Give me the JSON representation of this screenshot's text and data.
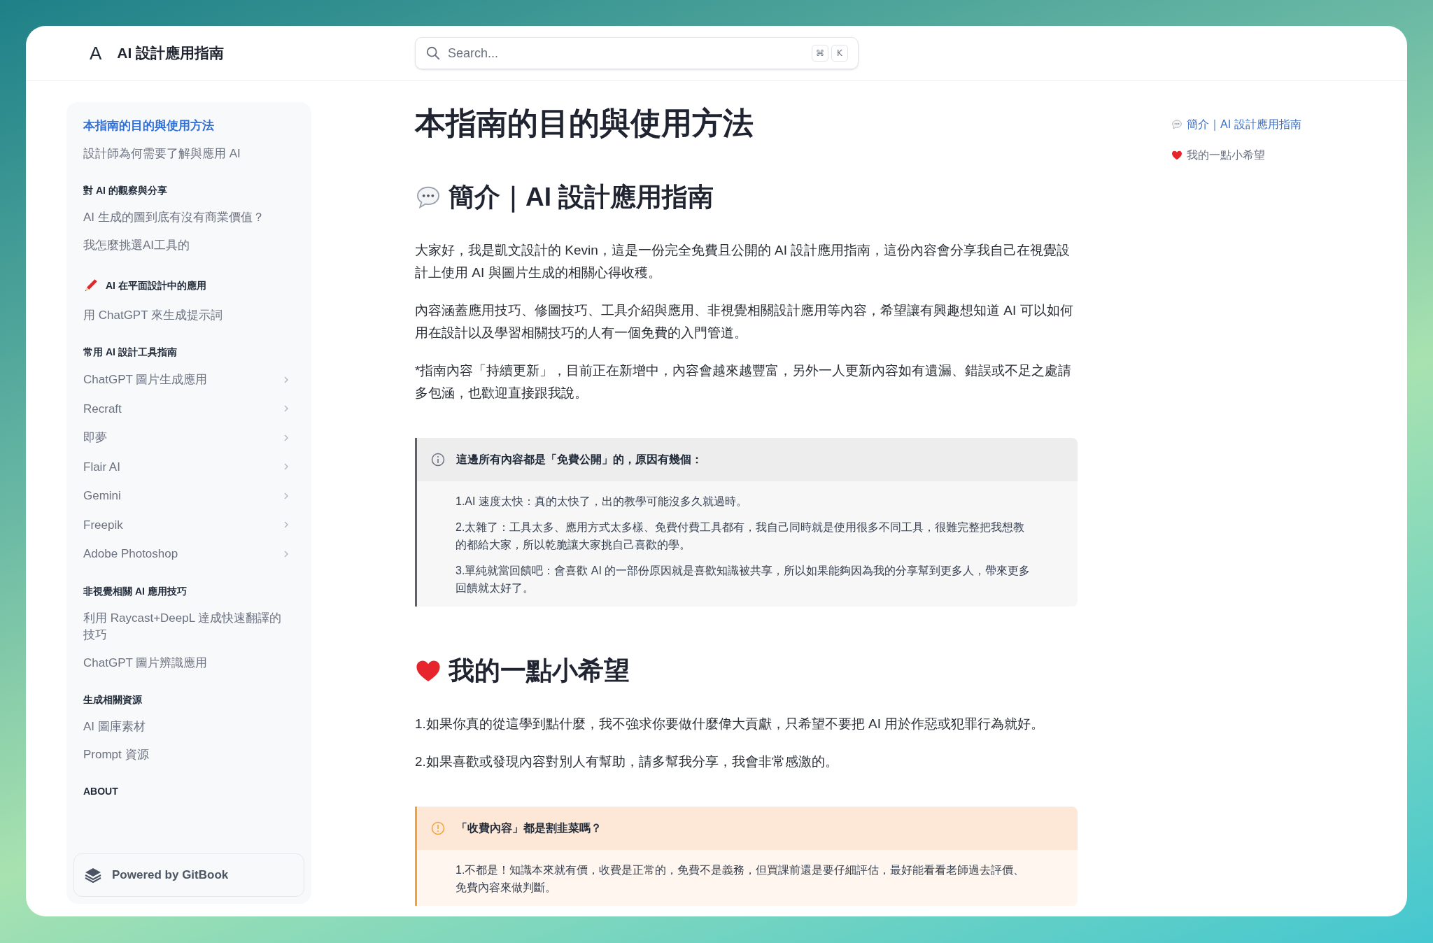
{
  "site": {
    "logo": "A",
    "title": "AI 設計應用指南"
  },
  "search": {
    "placeholder": "Search...",
    "shortcut": [
      "⌘",
      "K"
    ]
  },
  "sidebar": {
    "items": [
      {
        "kind": "page",
        "text": "本指南的目的與使用方法",
        "selected": true
      },
      {
        "kind": "page",
        "text": "設計師為何需要了解與應用 AI",
        "selected": false
      },
      {
        "kind": "section",
        "text": "對 AI 的觀察與分享"
      },
      {
        "kind": "page",
        "text": "AI 生成的圖到底有沒有商業價值？",
        "selected": false
      },
      {
        "kind": "page",
        "text": "我怎麼挑選AI工具的",
        "selected": false
      },
      {
        "kind": "marked_section",
        "text": "AI 在平面設計中的應用"
      },
      {
        "kind": "page",
        "text": "用 ChatGPT 來生成提示詞",
        "selected": false
      },
      {
        "kind": "section",
        "text": "常用 AI 設計工具指南"
      },
      {
        "kind": "group",
        "text": "ChatGPT 圖片生成應用",
        "selected": false
      },
      {
        "kind": "group",
        "text": "Recraft",
        "selected": false
      },
      {
        "kind": "group",
        "text": "即夢",
        "selected": false
      },
      {
        "kind": "group",
        "text": "Flair AI",
        "selected": false
      },
      {
        "kind": "group",
        "text": "Gemini",
        "selected": false
      },
      {
        "kind": "group",
        "text": "Freepik",
        "selected": false
      },
      {
        "kind": "group",
        "text": "Adobe Photoshop",
        "selected": false
      },
      {
        "kind": "section",
        "text": "非視覺相關 AI 應用技巧"
      },
      {
        "kind": "page",
        "text": "利用 Raycast+DeepL 達成快速翻譯的技巧",
        "selected": false
      },
      {
        "kind": "page",
        "text": "ChatGPT 圖片辨識應用",
        "selected": false
      },
      {
        "kind": "section",
        "text": "生成相關資源"
      },
      {
        "kind": "page",
        "text": "AI 圖庫素材",
        "selected": false
      },
      {
        "kind": "page",
        "text": "Prompt 資源",
        "selected": false
      },
      {
        "kind": "section",
        "text": "ABOUT"
      }
    ],
    "footer": "Powered by GitBook"
  },
  "article": {
    "title": "本指南的目的與使用方法",
    "blocks": [
      {
        "kind": "heading",
        "text": "簡介｜AI 設計應用指南"
      },
      {
        "kind": "paragraph",
        "text": "大家好，我是凱文設計的 Kevin，這是一份完全免費且公開的 AI 設計應用指南，這份內容會分享我自己在視覺設計上使用 AI 與圖片生成的相關心得收穫。"
      },
      {
        "kind": "paragraph",
        "text": "內容涵蓋應用技巧、修圖技巧、工具介紹與應用、非視覺相關設計應用等內容，希望讓有興趣想知道 AI 可以如何用在設計以及學習相關技巧的人有一個免費的入門管道。"
      },
      {
        "kind": "paragraph",
        "text": "*指南內容「持續更新」，目前正在新增中，內容會越來越豐富，另外一人更新內容如有遺漏、錯誤或不足之處請多包涵，也歡迎直接跟我說。"
      },
      {
        "kind": "info_callout",
        "title": "這邊所有內容都是「免費公開」的，原因有幾個：",
        "items": [
          "1.AI 速度太快：真的太快了，出的教學可能沒多久就過時。",
          "2.太雜了：工具太多、應用方式太多樣、免費付費工具都有，我自己同時就是使用很多不同工具，很難完整把我想教的都給大家，所以乾脆讓大家挑自己喜歡的學。",
          "3.單純就當回饋吧：會喜歡 AI 的一部份原因就是喜歡知識被共享，所以如果能夠因為我的分享幫到更多人，帶來更多回饋就太好了。"
        ]
      },
      {
        "kind": "heading",
        "text": "我的一點小希望"
      },
      {
        "kind": "paragraph",
        "text": "1.如果你真的從這學到點什麼，我不強求你要做什麼偉大貢獻，只希望不要把 AI 用於作惡或犯罪行為就好。"
      },
      {
        "kind": "paragraph",
        "text": "2.如果喜歡或發現內容對別人有幫助，請多幫我分享，我會非常感激的。"
      },
      {
        "kind": "warning_callout",
        "title": "「收費內容」都是割韭菜嗎？",
        "items": [
          "1.不都是！知識本來就有價，收費是正常的，免費不是義務，但買課前還是要仔細評估，最好能看看老師過去評價、免費內容來做判斷。"
        ]
      }
    ]
  },
  "toc": [
    {
      "text": "簡介｜AI 設計應用指南",
      "selected": true
    },
    {
      "text": "我的一點小希望",
      "selected": false
    }
  ]
}
